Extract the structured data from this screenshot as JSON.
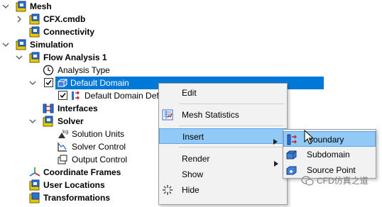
{
  "tree": {
    "mesh": {
      "label": "Mesh"
    },
    "cfx_cmdb": {
      "label": "CFX.cmdb"
    },
    "connectivity": {
      "label": "Connectivity"
    },
    "simulation": {
      "label": "Simulation"
    },
    "flow_analysis": {
      "label": "Flow Analysis 1"
    },
    "analysis_type": {
      "label": "Analysis Type"
    },
    "default_domain": {
      "label": "Default Domain"
    },
    "default_domain_default": {
      "label": "Default Domain Defa"
    },
    "interfaces": {
      "label": "Interfaces"
    },
    "solver": {
      "label": "Solver"
    },
    "solution_units": {
      "label": "Solution Units"
    },
    "solver_control": {
      "label": "Solver Control"
    },
    "output_control": {
      "label": "Output Control"
    },
    "coordinate_frames": {
      "label": "Coordinate Frames"
    },
    "user_locations": {
      "label": "User Locations"
    },
    "transformations": {
      "label": "Transformations"
    }
  },
  "context_menu": {
    "edit": "Edit",
    "mesh_statistics": "Mesh Statistics",
    "insert": "Insert",
    "render": "Render",
    "show": "Show",
    "hide": "Hide"
  },
  "insert_submenu": {
    "boundary": "Boundary",
    "subdomain": "Subdomain",
    "source_point": "Source Point"
  },
  "watermark": {
    "text": "CFD仿真之道"
  },
  "colors": {
    "selection": "#0078d7",
    "menu_highlight": "#91c9f7",
    "menu_background": "#f2f2f2"
  }
}
